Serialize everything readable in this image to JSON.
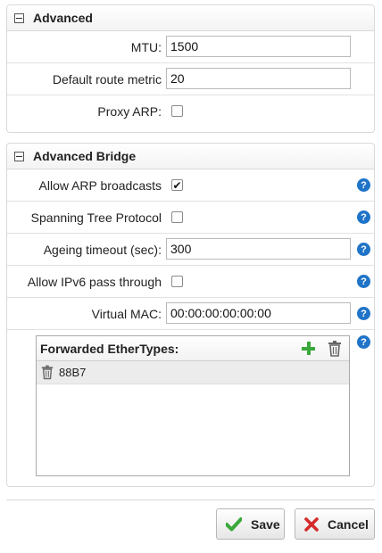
{
  "advanced": {
    "title": "Advanced",
    "mtu": {
      "label": "MTU:",
      "value": "1500"
    },
    "metric": {
      "label": "Default route metric",
      "value": "20"
    },
    "proxy_arp": {
      "label": "Proxy ARP:",
      "checked": false
    }
  },
  "bridge": {
    "title": "Advanced Bridge",
    "arp_broadcasts": {
      "label": "Allow ARP broadcasts",
      "checked": true
    },
    "stp": {
      "label": "Spanning Tree Protocol",
      "checked": false
    },
    "ageing": {
      "label": "Ageing timeout (sec):",
      "value": "300"
    },
    "ipv6": {
      "label": "Allow IPv6 pass through",
      "checked": false
    },
    "mac": {
      "label": "Virtual MAC:",
      "value": "00:00:00:00:00:00"
    },
    "ethertypes": {
      "title": "Forwarded EtherTypes:",
      "items": [
        "88B7"
      ]
    }
  },
  "help_glyph": "?",
  "check_glyph": "✔",
  "buttons": {
    "save": "Save",
    "cancel": "Cancel"
  },
  "colors": {
    "help": "#1f74c8",
    "add": "#3aa83a",
    "save_check": "#3aa83a",
    "cancel_x": "#d42a2a"
  },
  "icons": [
    "collapse-icon",
    "help-icon",
    "plus-icon",
    "trash-icon",
    "checkmark-icon",
    "cross-icon"
  ]
}
